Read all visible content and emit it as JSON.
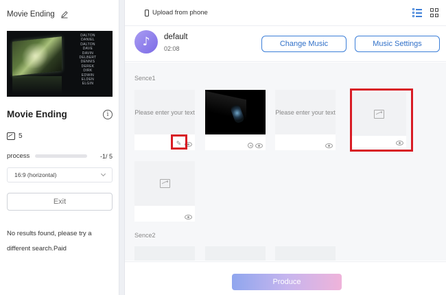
{
  "sidebar": {
    "title": "Movie Ending",
    "credits": [
      "DALTON",
      "DANIEL",
      "DALTON",
      "DAVE",
      "DAVIN",
      "DELBERT",
      "DENNIS",
      "DEREK",
      "DIRK",
      "EDWIN",
      "ELDEN",
      "ELGIN"
    ],
    "project_name": "Movie Ending",
    "image_count": "5",
    "process_label": "process",
    "process_count": "-1/ 5",
    "aspect_ratio": "16:9 (horizontal)",
    "exit_label": "Exit",
    "no_results": "No results found, please try a different search.Paid"
  },
  "topbar": {
    "upload_label": "Upload from phone"
  },
  "music": {
    "name": "default",
    "duration": "02:08",
    "change_label": "Change Music",
    "settings_label": "Music Settings"
  },
  "scenes": [
    {
      "label": "Sence1"
    },
    {
      "label": "Sence2"
    }
  ],
  "cards": {
    "text_placeholder_1": "Please enter your text",
    "text_placeholder_2": "Please enter your text"
  },
  "footer": {
    "produce_label": "Produce"
  },
  "colors": {
    "accent": "#3b7ed8",
    "highlight": "#d81b24"
  }
}
